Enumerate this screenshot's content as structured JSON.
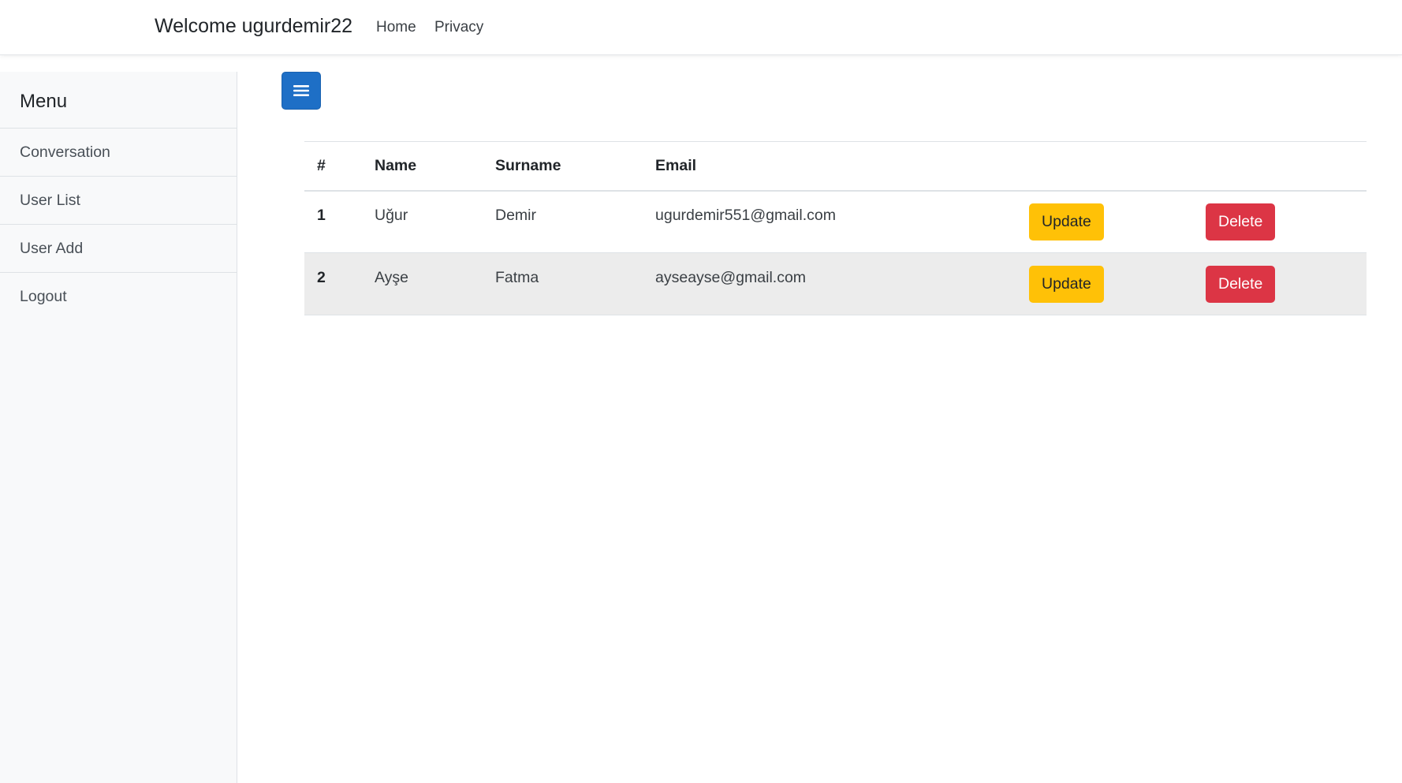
{
  "navbar": {
    "brand": "Welcome ugurdemir22",
    "links": [
      "Home",
      "Privacy"
    ]
  },
  "sidebar": {
    "heading": "Menu",
    "items": [
      "Conversation",
      "User List",
      "User Add",
      "Logout"
    ]
  },
  "toggle_icon": "hamburger-menu-icon",
  "table": {
    "headers": [
      "#",
      "Name",
      "Surname",
      "Email"
    ],
    "rows": [
      {
        "num": "1",
        "name": "Uğur",
        "surname": "Demir",
        "email": "ugurdemir551@gmail.com",
        "update_label": "Update",
        "delete_label": "Delete"
      },
      {
        "num": "2",
        "name": "Ayşe",
        "surname": "Fatma",
        "email": "ayseayse@gmail.com",
        "update_label": "Update",
        "delete_label": "Delete"
      }
    ]
  },
  "colors": {
    "primary": "#1e6fc6",
    "warning": "#ffc107",
    "danger": "#dc3545",
    "sidebar_bg": "#f8f9fa",
    "stripe": "#ececec"
  }
}
